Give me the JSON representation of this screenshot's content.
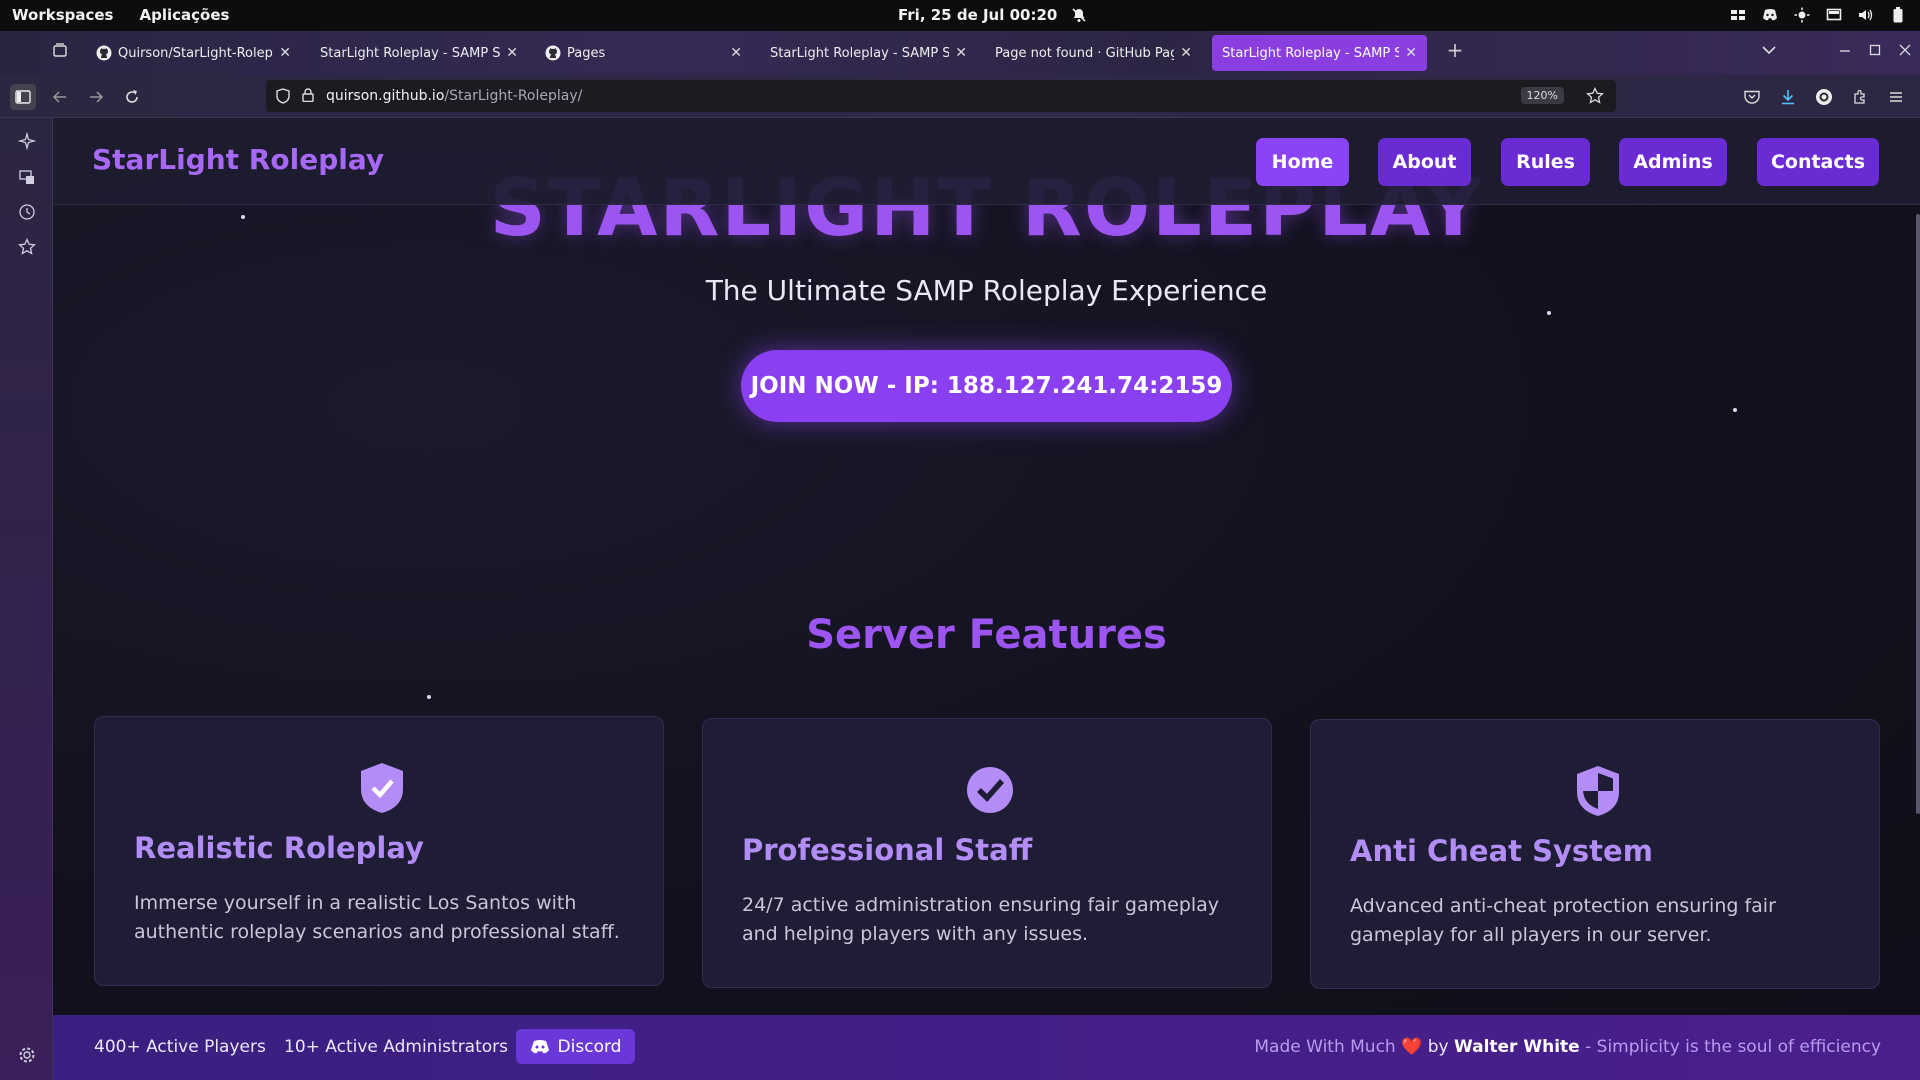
{
  "system_bar": {
    "workspaces": "Workspaces",
    "apps": "Aplicações",
    "datetime": "Fri, 25 de Jul  00:20"
  },
  "browser": {
    "tabs": [
      {
        "label": "Quirson/StarLight-Roleplay",
        "favicon": "github-icon"
      },
      {
        "label": "StarLight Roleplay - SAMP Serve",
        "favicon": ""
      },
      {
        "label": "Pages",
        "favicon": "github-icon"
      },
      {
        "label": "StarLight Roleplay - SAMP Serve",
        "favicon": ""
      },
      {
        "label": "Page not found · GitHub Pages",
        "favicon": ""
      },
      {
        "label": "StarLight Roleplay - SAMP Serve",
        "favicon": "",
        "active": true
      }
    ],
    "url_host": "quirson.github.io",
    "url_path": "/StarLight-Roleplay/",
    "zoom": "120%"
  },
  "site": {
    "brand": "StarLight Roleplay",
    "nav": [
      "Home",
      "About",
      "Rules",
      "Admins",
      "Contacts"
    ],
    "active_nav": "Home",
    "hero_title": "STARLIGHT ROLEPLAY",
    "tagline": "The Ultimate SAMP Roleplay Experience",
    "join_button": "JOIN NOW - IP: 188.127.241.74:2159",
    "features_title": "Server Features",
    "features": [
      {
        "icon": "shield-check-icon",
        "title": "Realistic Roleplay",
        "desc": "Immerse yourself in a realistic Los Santos with authentic roleplay scenarios and professional staff."
      },
      {
        "icon": "check-circle-icon",
        "title": "Professional Staff",
        "desc": "24/7 active administration ensuring fair gameplay and helping players with any issues."
      },
      {
        "icon": "shield-halved-icon",
        "title": "Anti Cheat System",
        "desc": "Advanced anti-cheat protection ensuring fair gameplay for all players in our server."
      }
    ],
    "footer": {
      "players": "400+ Active Players",
      "admins": "10+ Active Administrators",
      "discord": "Discord",
      "credit_prefix": "Made With Much",
      "credit_by": "by",
      "credit_author": "Walter White",
      "credit_suffix": "- Simplicity is the soul of efficiency"
    }
  },
  "colors": {
    "accent": "#8a3ff0",
    "nav_button": "#6a2bd3",
    "footer_bg": "#3a1f80"
  }
}
